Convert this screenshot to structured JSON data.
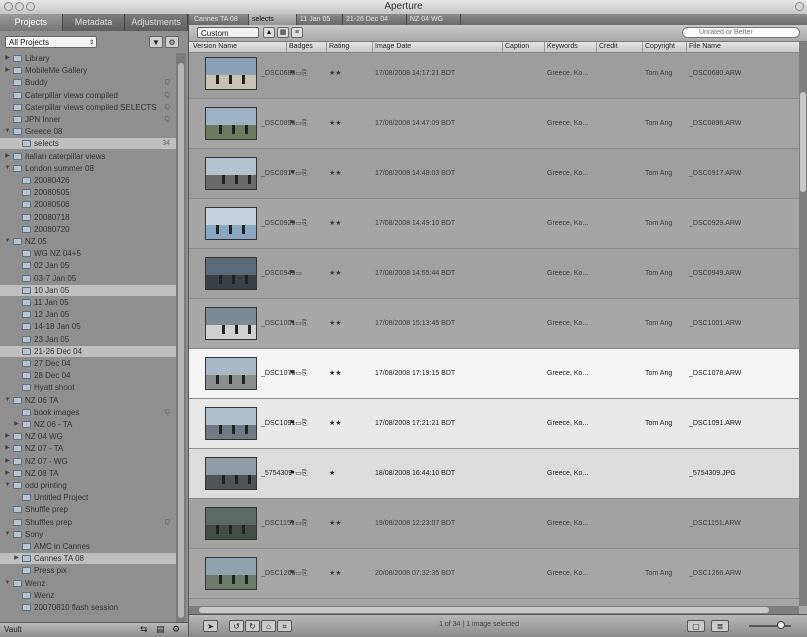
{
  "window": {
    "title": "Aperture"
  },
  "sidebar": {
    "tabs": [
      "Projects",
      "Metadata",
      "Adjustments"
    ],
    "project_filter": "All Projects",
    "bottom_label": "Vault",
    "tree": [
      {
        "label": "Library",
        "indent": 0,
        "tw": "▶",
        "count": ""
      },
      {
        "label": "MobileMe Gallery",
        "indent": 0,
        "tw": "▶",
        "count": ""
      },
      {
        "label": "Buddy",
        "indent": 0,
        "tw": "",
        "count": "Q"
      },
      {
        "label": "Caterpillar views compiled",
        "indent": 0,
        "tw": "",
        "count": "Q"
      },
      {
        "label": "Caterpillar views compiled SELECTS",
        "indent": 0,
        "tw": "",
        "count": "Q"
      },
      {
        "label": "JPN Inner",
        "indent": 0,
        "tw": "",
        "count": "Q"
      },
      {
        "label": "Greece 08",
        "indent": 0,
        "tw": "▼",
        "count": ""
      },
      {
        "label": "selects",
        "indent": 1,
        "tw": "",
        "count": "34",
        "sel": true
      },
      {
        "label": "Italian caterpillar views",
        "indent": 0,
        "tw": "▶",
        "count": ""
      },
      {
        "label": "London summer 08",
        "indent": 0,
        "tw": "▼",
        "count": ""
      },
      {
        "label": "20080426",
        "indent": 1,
        "tw": "",
        "count": ""
      },
      {
        "label": "20080505",
        "indent": 1,
        "tw": "",
        "count": ""
      },
      {
        "label": "20080506",
        "indent": 1,
        "tw": "",
        "count": ""
      },
      {
        "label": "20080718",
        "indent": 1,
        "tw": "",
        "count": ""
      },
      {
        "label": "20080720",
        "indent": 1,
        "tw": "",
        "count": ""
      },
      {
        "label": "NZ 05",
        "indent": 0,
        "tw": "▼",
        "count": ""
      },
      {
        "label": "WG NZ 04+5",
        "indent": 1,
        "tw": "",
        "count": ""
      },
      {
        "label": "02 Jan 05",
        "indent": 1,
        "tw": "",
        "count": ""
      },
      {
        "label": "03-7 Jan 05",
        "indent": 1,
        "tw": "",
        "count": ""
      },
      {
        "label": "10 Jan 05",
        "indent": 1,
        "tw": "",
        "count": "",
        "sel": true
      },
      {
        "label": "11 Jan 05",
        "indent": 1,
        "tw": "",
        "count": ""
      },
      {
        "label": "12 Jan 05",
        "indent": 1,
        "tw": "",
        "count": ""
      },
      {
        "label": "14-18 Jan 05",
        "indent": 1,
        "tw": "",
        "count": ""
      },
      {
        "label": "23 Jan 05",
        "indent": 1,
        "tw": "",
        "count": ""
      },
      {
        "label": "21-26 Dec 04",
        "indent": 1,
        "tw": "",
        "count": "",
        "sel": true
      },
      {
        "label": "27 Dec 04",
        "indent": 1,
        "tw": "",
        "count": ""
      },
      {
        "label": "28 Dec 04",
        "indent": 1,
        "tw": "",
        "count": ""
      },
      {
        "label": "Hyatt shoot",
        "indent": 1,
        "tw": "",
        "count": ""
      },
      {
        "label": "NZ 06 TA",
        "indent": 0,
        "tw": "▼",
        "count": ""
      },
      {
        "label": "book images",
        "indent": 1,
        "tw": "",
        "count": "Q"
      },
      {
        "label": "NZ 06 - TA",
        "indent": 1,
        "tw": "▶",
        "count": ""
      },
      {
        "label": "NZ 04 WG",
        "indent": 0,
        "tw": "▶",
        "count": ""
      },
      {
        "label": "NZ 07 - TA",
        "indent": 0,
        "tw": "▶",
        "count": ""
      },
      {
        "label": "NZ 07 - WG",
        "indent": 0,
        "tw": "▶",
        "count": ""
      },
      {
        "label": "NZ 08 TA",
        "indent": 0,
        "tw": "▶",
        "count": ""
      },
      {
        "label": "odd printing",
        "indent": 0,
        "tw": "▼",
        "count": ""
      },
      {
        "label": "Untitled Project",
        "indent": 1,
        "tw": "",
        "count": ""
      },
      {
        "label": "Shuffle prep",
        "indent": 0,
        "tw": "",
        "count": ""
      },
      {
        "label": "Shuffles prep",
        "indent": 0,
        "tw": "",
        "count": "Q"
      },
      {
        "label": "Sony",
        "indent": 0,
        "tw": "▼",
        "count": ""
      },
      {
        "label": "AMC in Cannes",
        "indent": 1,
        "tw": "",
        "count": ""
      },
      {
        "label": "Cannes TA 08",
        "indent": 1,
        "tw": "▶",
        "count": "",
        "sel": true
      },
      {
        "label": "Press pix",
        "indent": 1,
        "tw": "",
        "count": ""
      },
      {
        "label": "Wenz",
        "indent": 0,
        "tw": "▼",
        "count": ""
      },
      {
        "label": "Wenz",
        "indent": 1,
        "tw": "",
        "count": ""
      },
      {
        "label": "20070810 flash session",
        "indent": 1,
        "tw": "",
        "count": ""
      }
    ]
  },
  "browser": {
    "tabs": [
      "Cannes TA 08",
      "selects",
      "11 Jan 05",
      "21-26 Dec 04",
      "NZ 04 WG"
    ],
    "active_tab": 1,
    "view_preset": "Custom",
    "search_placeholder": "Unrated or Better",
    "status": "1 of 34 | 1 image selected",
    "columns": [
      "Version Name",
      "Badges",
      "Rating",
      "Image Date",
      "Caption",
      "Keywords",
      "Credit",
      "Copyright",
      "File Name"
    ],
    "rows": [
      {
        "name": "_DSC0680",
        "badges": "⚑▭⎘",
        "rating": "★★",
        "date": "17/08/2008 14:17:21 BDT",
        "caption": "",
        "keywords": "Greece, Ko...",
        "credit": "",
        "copyright": "Tom Ang",
        "file": "_DSC0680.ARW",
        "shade": "#9d9d9d",
        "thumb": "#8aa0b4",
        "land": "#c8c2b5"
      },
      {
        "name": "_DSC0896",
        "badges": "⚑▭⎘",
        "rating": "★★",
        "date": "17/08/2008 14:47:09 BDT",
        "caption": "",
        "keywords": "Greece, Ko...",
        "credit": "",
        "copyright": "Tom Ang",
        "file": "_DSC0896.ARW",
        "shade": "#a4a4a4",
        "thumb": "#9cb2c4",
        "land": "#6c7a5e"
      },
      {
        "name": "_DSC0917",
        "badges": "⚑▭⎘",
        "rating": "★★",
        "date": "17/08/2008 14:48:03 BDT",
        "caption": "",
        "keywords": "Greece, Ko...",
        "credit": "",
        "copyright": "Tom Ang",
        "file": "_DSC0917.ARW",
        "shade": "#9f9f9f",
        "thumb": "#b4c2d0",
        "land": "#6a6a6a"
      },
      {
        "name": "_DSC0929",
        "badges": "⚑▭⎘",
        "rating": "★★",
        "date": "17/08/2008 14:49:10 BDT",
        "caption": "",
        "keywords": "Greece, Ko...",
        "credit": "",
        "copyright": "Tom Ang",
        "file": "_DSC0929.ARW",
        "shade": "#a5a5a5",
        "thumb": "#c5d2de",
        "land": "#8aa8c4"
      },
      {
        "name": "_DSC0949",
        "badges": "⚑▭",
        "rating": "★★",
        "date": "17/08/2008 14:55:44 BDT",
        "caption": "",
        "keywords": "Greece, Ko...",
        "credit": "",
        "copyright": "Tom Ang",
        "file": "_DSC0949.ARW",
        "shade": "#a1a1a1",
        "thumb": "#5a6a7a",
        "land": "#3a4048"
      },
      {
        "name": "_DSC1001",
        "badges": "⚑▭⎘",
        "rating": "★★",
        "date": "17/08/2008 15:13:45 BDT",
        "caption": "",
        "keywords": "Greece, Ko...",
        "credit": "",
        "copyright": "Tom Ang",
        "file": "_DSC1001.ARW",
        "shade": "#a7a7a7",
        "thumb": "#7c8a96",
        "land": "#d0d0d0"
      },
      {
        "name": "_DSC1078",
        "badges": "⚑▭⎘",
        "rating": "★★",
        "date": "17/08/2008 17:19:15 BDT",
        "caption": "",
        "keywords": "Greece, Ko...",
        "credit": "",
        "copyright": "Tom Ang",
        "file": "_DSC1078.ARW",
        "shade": "#f4f4f4",
        "thumb": "#a8b8c6",
        "land": "#8a8e8e"
      },
      {
        "name": "_DSC1091",
        "badges": "⚑▭⎘",
        "rating": "★★",
        "date": "17/08/2008 17:21:21 BDT",
        "caption": "",
        "keywords": "Greece, Ko...",
        "credit": "",
        "copyright": "Tom Ang",
        "file": "_DSC1091.ARW",
        "shade": "#e8e8e8",
        "thumb": "#b0bfcc",
        "land": "#6f7a86"
      },
      {
        "name": "_5754309",
        "badges": "⚑▭⎘",
        "rating": "★",
        "date": "18/08/2008 16:44:10 BDT",
        "caption": "",
        "keywords": "Greece, Ko...",
        "credit": "",
        "copyright": "",
        "file": "_5754309.JPG",
        "shade": "#dcdcdc",
        "thumb": "#8e9aa4",
        "land": "#4e5458"
      },
      {
        "name": "_DSC1151",
        "badges": "⚑▭⎘",
        "rating": "★★",
        "date": "19/08/2008 12:23:07 BDT",
        "caption": "",
        "keywords": "Greece, Ko...",
        "credit": "",
        "copyright": "",
        "file": "_DSC1151.ARW",
        "shade": "#a2a2a2",
        "thumb": "#5c6a66",
        "land": "#444c48"
      },
      {
        "name": "_DSC1266",
        "badges": "⚑▭⎘",
        "rating": "★★",
        "date": "20/08/2008 07:32:35 BDT",
        "caption": "",
        "keywords": "Greece, Ko...",
        "credit": "",
        "copyright": "Tom Ang",
        "file": "_DSC1266.ARW",
        "shade": "#a6a6a6",
        "thumb": "#8fa2b0",
        "land": "#6e7c6c"
      }
    ]
  }
}
